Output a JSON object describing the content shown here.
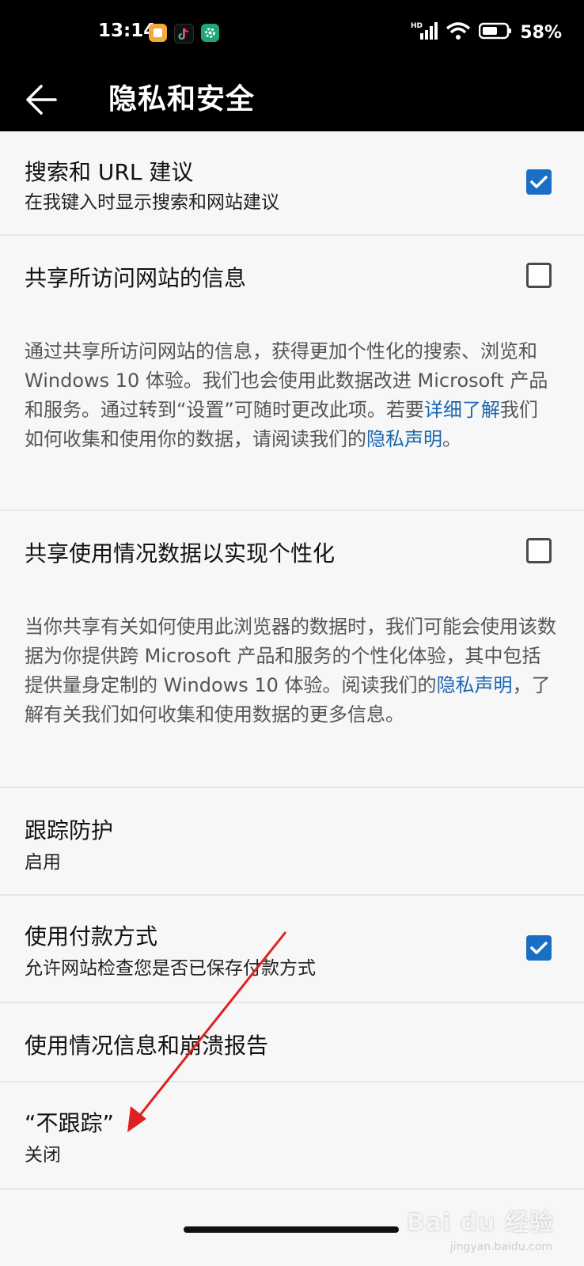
{
  "status_bar": {
    "time": "13:14",
    "signal_label": "HD",
    "battery_percent": "58%"
  },
  "header": {
    "title": "隐私和安全",
    "back_icon": "arrow-left-icon"
  },
  "settings": [
    {
      "title": "搜索和 URL 建议",
      "subtitle": "在我键入时显示搜索和网站建议",
      "checked": true
    },
    {
      "title": "共享所访问网站的信息",
      "checked": false,
      "description_parts": [
        "通过共享所访问网站的信息，获得更加个性化的搜索、浏览和 Windows 10 体验。我们也会使用此数据改进 Microsoft 产品和服务。通过转到“设置”可随时更改此项。若要",
        "详细了解",
        "我们如何收集和使用你的数据，请阅读我们的",
        "隐私声明",
        "。"
      ]
    },
    {
      "title": "共享使用情况数据以实现个性化",
      "checked": false,
      "description_parts": [
        "当你共享有关如何使用此浏览器的数据时，我们可能会使用该数据为你提供跨 Microsoft 产品和服务的个性化体验，其中包括提供量身定制的 Windows 10 体验。阅读我们的",
        "隐私声明",
        "，了解有关我们如何收集和使用数据的更多信息。"
      ]
    },
    {
      "title": "跟踪防护",
      "subtitle": "启用"
    },
    {
      "title": "使用付款方式",
      "subtitle": "允许网站检查您是否已保存付款方式",
      "checked": true
    },
    {
      "title": "使用情况信息和崩溃报告"
    },
    {
      "title": "“不跟踪”",
      "subtitle": "关闭"
    }
  ],
  "watermark": {
    "logo": "Bai du 经验",
    "sub": "jingyan.baidu.com"
  },
  "colors": {
    "accent": "#1a6fc4",
    "link": "#1a67b0",
    "annotation_arrow": "#e02020"
  }
}
